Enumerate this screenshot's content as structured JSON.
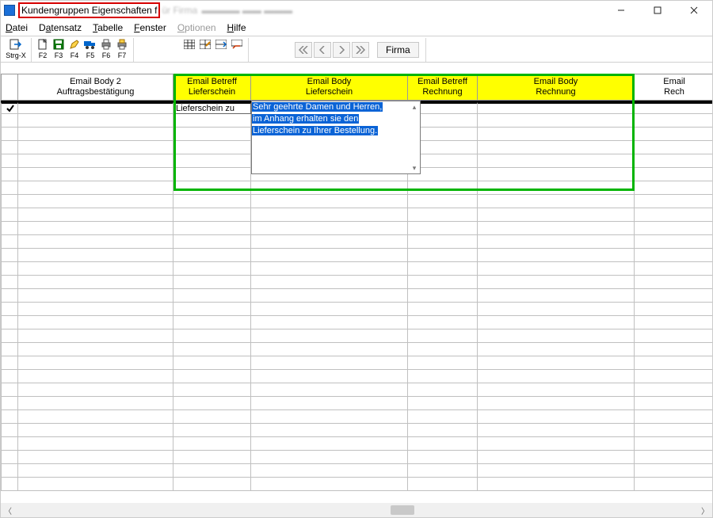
{
  "title": {
    "highlighted": "Kundengruppen Eigenschaften f",
    "suffix": "ür Firma"
  },
  "menu": {
    "datei": "Datei",
    "datensatz": "Datensatz",
    "tabelle": "Tabelle",
    "fenster": "Fenster",
    "optionen": "Optionen",
    "hilfe": "Hilfe"
  },
  "toolbar": {
    "labels": {
      "strgx": "Strg-X",
      "f2": "F2",
      "f3": "F3",
      "f4": "F4",
      "f5": "F5",
      "f6": "F6",
      "f7": "F7"
    },
    "firma": "Firma"
  },
  "columns": {
    "selector_w": 22,
    "c1": {
      "l1": "Email Body 2",
      "l2": "Auftragsbestätigung",
      "w": 196
    },
    "c2": {
      "l1": "Email Betreff",
      "l2": "Lieferschein",
      "w": 98
    },
    "c3": {
      "l1": "Email Body",
      "l2": "Lieferschein",
      "w": 198
    },
    "c4": {
      "l1": "Email Betreff",
      "l2": "Rechnung",
      "w": 88
    },
    "c5": {
      "l1": "Email Body",
      "l2": "Rechnung",
      "w": 198
    },
    "c6": {
      "l1": "Email",
      "l2": "Rech",
      "w": 100
    }
  },
  "row1": {
    "c2": "Lieferschein zu",
    "c3_lines": [
      "Sehr geehrte Damen und Herren,",
      "im Anhang erhalten sie den",
      "Lieferschein zu Ihrer Bestellung."
    ]
  }
}
